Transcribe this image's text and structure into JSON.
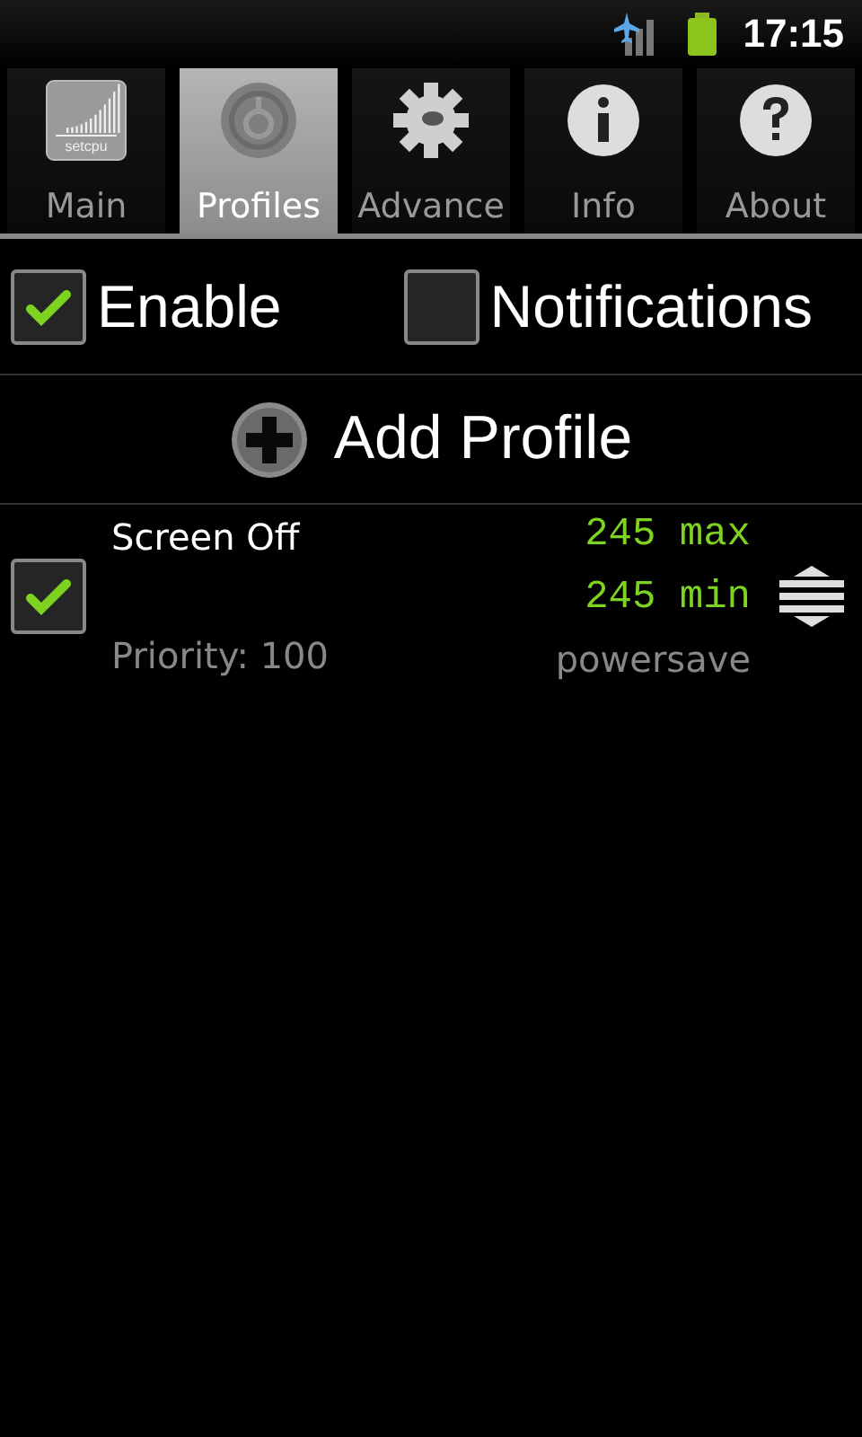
{
  "status_bar": {
    "time": "17:15"
  },
  "tabs": [
    {
      "label": "Main",
      "kind": "chart",
      "icon_text": "setcpu",
      "selected": false
    },
    {
      "label": "Profiles",
      "kind": "dial",
      "selected": true
    },
    {
      "label": "Advance",
      "kind": "gear",
      "selected": false
    },
    {
      "label": "Info",
      "kind": "info",
      "selected": false
    },
    {
      "label": "About",
      "kind": "help",
      "selected": false
    }
  ],
  "options": [
    {
      "label": "Enable",
      "checked": true
    },
    {
      "label": "Notifications",
      "checked": false
    }
  ],
  "add_button": {
    "label": "Add Profile"
  },
  "profiles": [
    {
      "name": "Screen Off",
      "priority": "Priority: 100",
      "max": "245 max",
      "min": "245 min",
      "governor": "powersave",
      "checked": true
    }
  ]
}
